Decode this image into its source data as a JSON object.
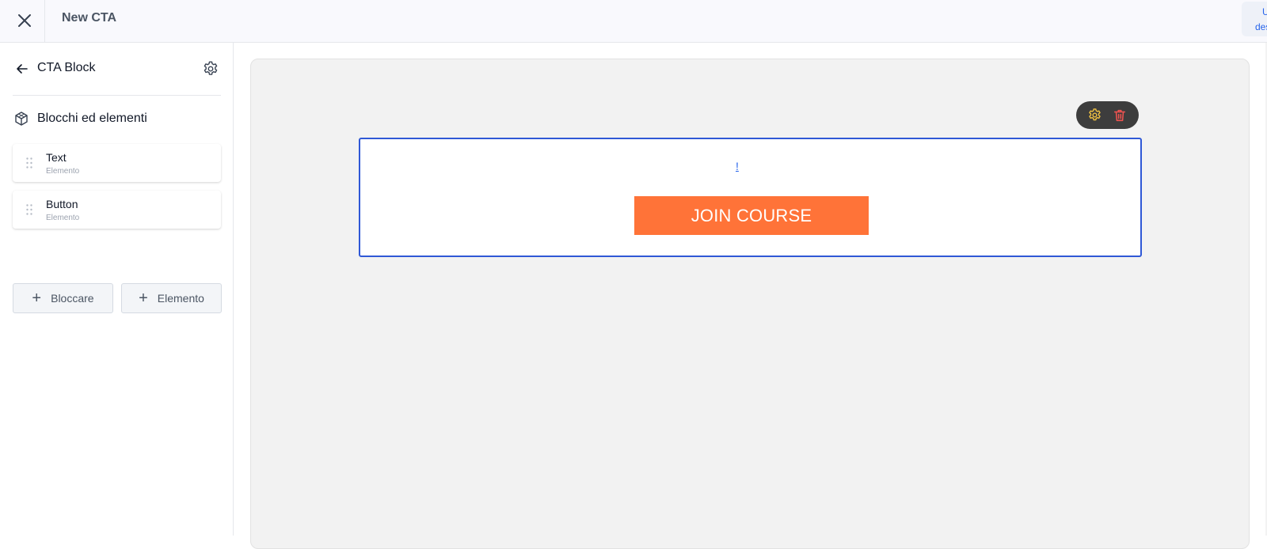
{
  "header": {
    "close_icon": "close-icon",
    "title": "New CTA",
    "right_button_line1": "U",
    "right_button_line2": "des"
  },
  "sidebar": {
    "back_icon": "arrow-left-icon",
    "block_title": "CTA Block",
    "settings_icon": "gear-icon",
    "section_icon": "cube-icon",
    "section_title": "Blocchi ed elementi",
    "elements": [
      {
        "name": "Text",
        "type": "Elemento"
      },
      {
        "name": "Button",
        "type": "Elemento"
      }
    ],
    "add_block_label": "Bloccare",
    "add_element_label": "Elemento"
  },
  "canvas": {
    "toolbar": {
      "settings_icon": "gear-icon",
      "delete_icon": "trash-icon",
      "settings_color": "#f5c542",
      "delete_color": "#ef5350"
    },
    "cta_text": "!",
    "cta_button_label": "JOIN COURSE",
    "cta_button_color": "#ff7338",
    "selection_color": "#2f58d6"
  }
}
